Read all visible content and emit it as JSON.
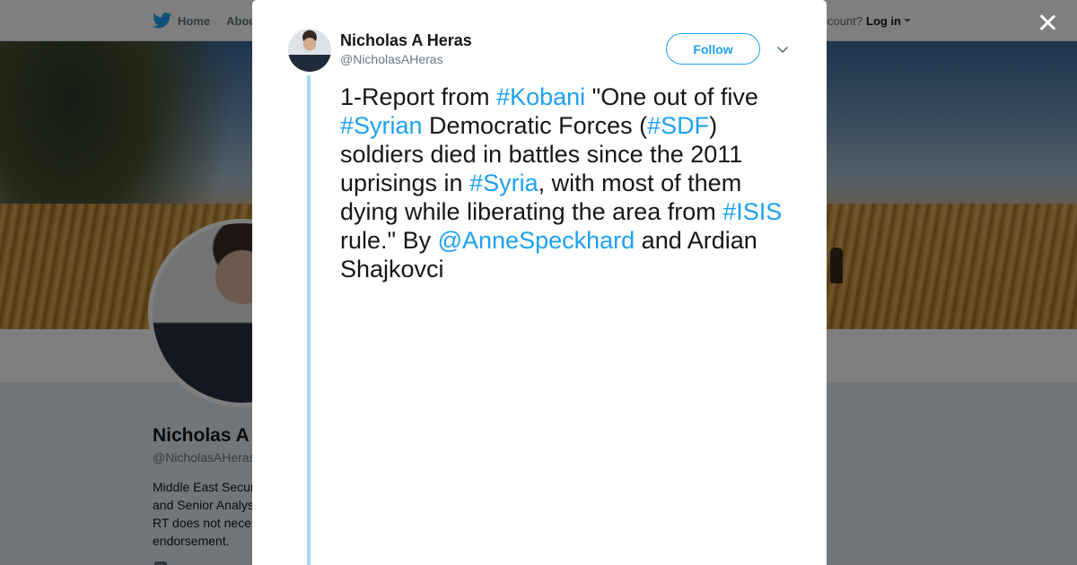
{
  "nav": {
    "home_label": "Home",
    "about_label": "About",
    "account_prompt": "Have an account?",
    "login_label": "Log in"
  },
  "profile": {
    "name": "Nicholas A Heras",
    "handle": "@NicholasAHeras",
    "bio_lines": [
      "Middle East Security Fellow",
      "and Senior Analyst...",
      "RT does not necessarily mean",
      "endorsement."
    ]
  },
  "tweet": {
    "author_name": "Nicholas A Heras",
    "author_handle": "@NicholasAHeras",
    "follow_label": "Follow",
    "segments": [
      {
        "text": "1-Report from ",
        "link": false
      },
      {
        "text": "#Kobani",
        "link": true
      },
      {
        "text": " \"One out of five ",
        "link": false
      },
      {
        "text": "#Syrian",
        "link": true
      },
      {
        "text": " Democratic Forces (",
        "link": false
      },
      {
        "text": "#SDF",
        "link": true
      },
      {
        "text": ") soldiers died in battles since the 2011 uprisings in ",
        "link": false
      },
      {
        "text": "#Syria",
        "link": true
      },
      {
        "text": ", with most of them dying while liberating the area from ",
        "link": false
      },
      {
        "text": "#ISIS",
        "link": true
      },
      {
        "text": " rule.\" By ",
        "link": false
      },
      {
        "text": "@AnneSpeckhard",
        "link": true
      },
      {
        "text": " and Ardian Shajkovci",
        "link": false
      }
    ]
  },
  "colors": {
    "accent": "#1da1f2",
    "thread_line": "#a4d9f5",
    "text": "#14171a",
    "muted": "#657786"
  },
  "icons": {
    "logo": "twitter-bird-icon",
    "home": "home-icon",
    "close": "close-icon",
    "more": "chevron-down-icon"
  }
}
